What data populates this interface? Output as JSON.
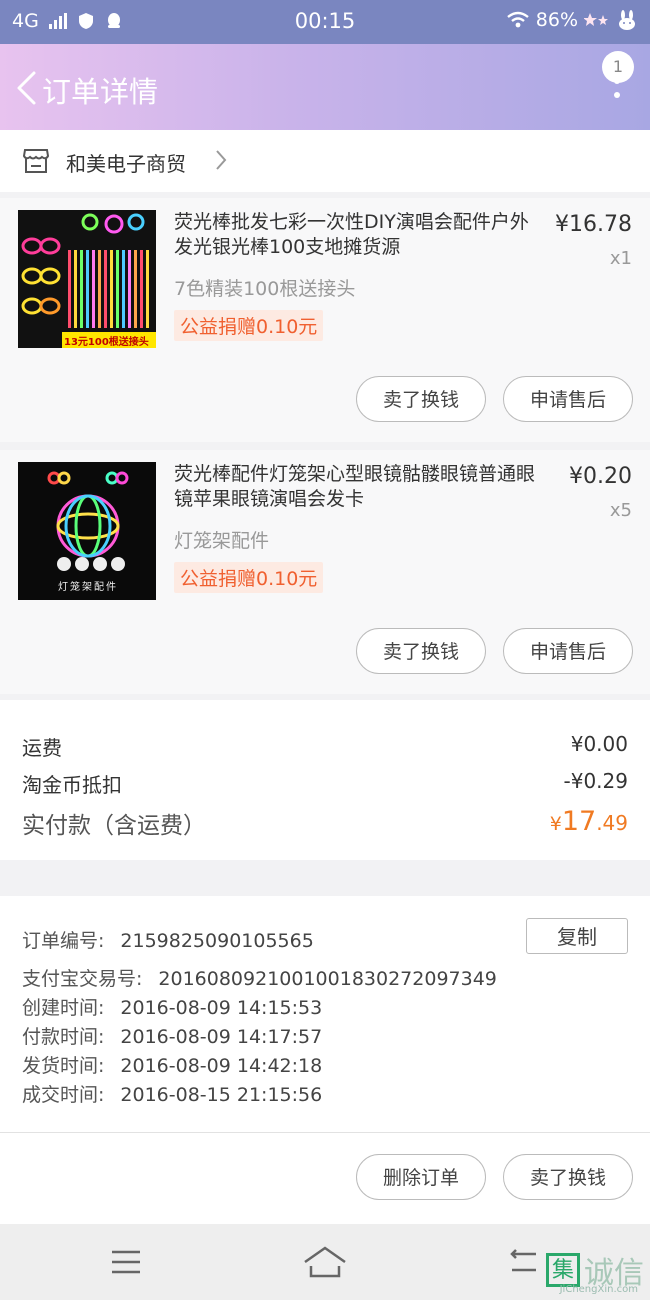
{
  "status_bar": {
    "network": "4G",
    "time": "00:15",
    "battery": "86%"
  },
  "header": {
    "title": "订单详情",
    "badge": "1"
  },
  "shop": {
    "name": "和美电子商贸"
  },
  "items": [
    {
      "title": "荧光棒批发七彩一次性DIY演唱会配件户外发光银光棒100支地摊货源",
      "price": "¥16.78",
      "qty": "x1",
      "spec": "7色精装100根送接头",
      "donate": "公益捐赠0.10元",
      "thumb_text": "13元100根送接头",
      "btn_sell": "卖了换钱",
      "btn_after": "申请售后"
    },
    {
      "title": "荧光棒配件灯笼架心型眼镜骷髅眼镜普通眼镜苹果眼镜演唱会发卡",
      "price": "¥0.20",
      "qty": "x5",
      "spec": "灯笼架配件",
      "donate": "公益捐赠0.10元",
      "thumb_text": "灯笼架配件",
      "btn_sell": "卖了换钱",
      "btn_after": "申请售后"
    }
  ],
  "summary": {
    "shipping_label": "运费",
    "shipping_value": "¥0.00",
    "coin_label": "淘金币抵扣",
    "coin_value": "-¥0.29",
    "total_label": "实付款（含运费）",
    "total_currency": "¥",
    "total_int": "17",
    "total_dec": ".49"
  },
  "order_info": {
    "order_no_label": "订单编号:",
    "order_no": "2159825090105565",
    "copy_label": "复制",
    "alipay_label": "支付宝交易号:",
    "alipay_no": "2016080921001001830272097349",
    "created_label": "创建时间:",
    "created": "2016-08-09 14:15:53",
    "paid_label": "付款时间:",
    "paid": "2016-08-09 14:17:57",
    "shipped_label": "发货时间:",
    "shipped": "2016-08-09 14:42:18",
    "closed_label": "成交时间:",
    "closed": "2016-08-15 21:15:56"
  },
  "actions": {
    "delete_label": "删除订单",
    "sell_label": "卖了换钱"
  },
  "watermark": {
    "mark": "集",
    "brand": "诚信",
    "url": "JiChengXin.com"
  },
  "colors": {
    "status_bar": "#7a86c0",
    "accent_orange": "#f07a22",
    "donate_red": "#f06030"
  }
}
